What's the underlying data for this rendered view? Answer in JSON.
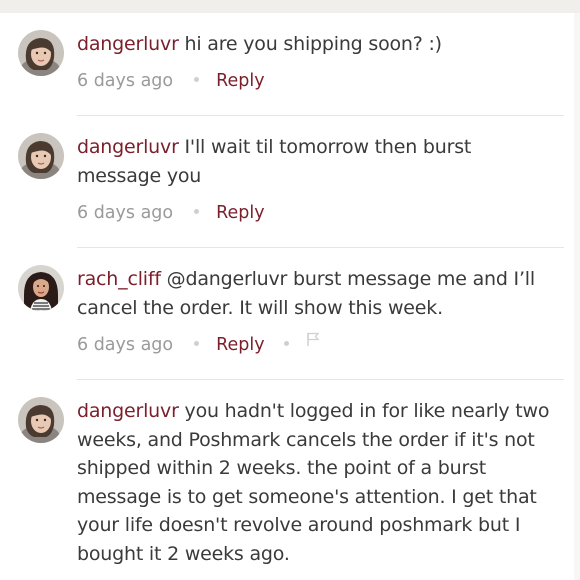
{
  "comments": [
    {
      "username": "dangerluvr",
      "message": "hi are you shipping soon? :)",
      "timestamp": "6 days ago",
      "reply_label": "Reply",
      "avatar": "dangerluvr-avatar"
    },
    {
      "username": "dangerluvr",
      "message": "I'll wait til tomorrow then burst message you",
      "timestamp": "6 days ago",
      "reply_label": "Reply",
      "avatar": "dangerluvr-avatar"
    },
    {
      "username": "rach_cliff",
      "message": "@dangerluvr burst message me and I’ll cancel the order. It will show this week.",
      "timestamp": "6 days ago",
      "reply_label": "Reply",
      "avatar": "rach_cliff-avatar",
      "flag_icon": "flag-icon"
    },
    {
      "username": "dangerluvr",
      "message": "you hadn't logged in for like nearly two weeks, and Poshmark cancels the order if it's not shipped within 2 weeks. the point of a burst message is to get someone's attention. I get that your life doesn't revolve around poshmark but I bought it 2 weeks ago.",
      "avatar": "dangerluvr-avatar"
    }
  ],
  "colors": {
    "username": "#7b1f2b",
    "text": "#3a3a3a",
    "meta": "#9a9a9a",
    "divider": "#e6e6e6"
  }
}
